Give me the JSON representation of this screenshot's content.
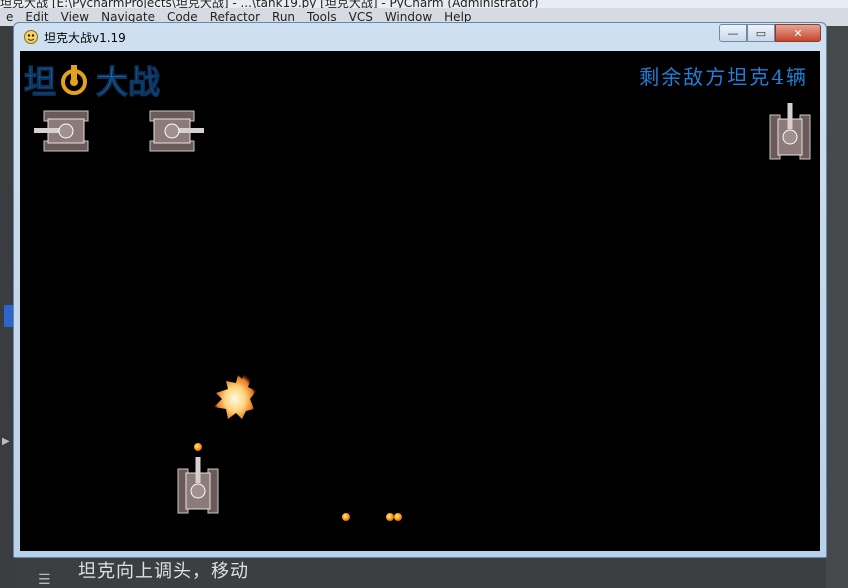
{
  "ide": {
    "title_text": "坦克大战 [E:\\PycharmProjects\\坦克大战] - ...\\tank19.py [坦克大战] - PyCharm (Administrator)",
    "menu": [
      "e",
      "Edit",
      "View",
      "Navigate",
      "Code",
      "Refactor",
      "Run",
      "Tools",
      "VCS",
      "Window",
      "Help"
    ],
    "bottom_text": "坦克向上调头，移动"
  },
  "window": {
    "title": "坦克大战v1.19",
    "buttons": {
      "minimize": "—",
      "maximize": "▭",
      "close": "✕"
    }
  },
  "game": {
    "logo_text": "坦克大战",
    "enemy_count_text": "剩余敌方坦克4辆",
    "enemies_remaining": 4,
    "colors": {
      "background": "#000000",
      "enemy_count_text": "#1f7fd8",
      "logo": "#1b74c6",
      "bullet": "#ff8a00"
    }
  }
}
